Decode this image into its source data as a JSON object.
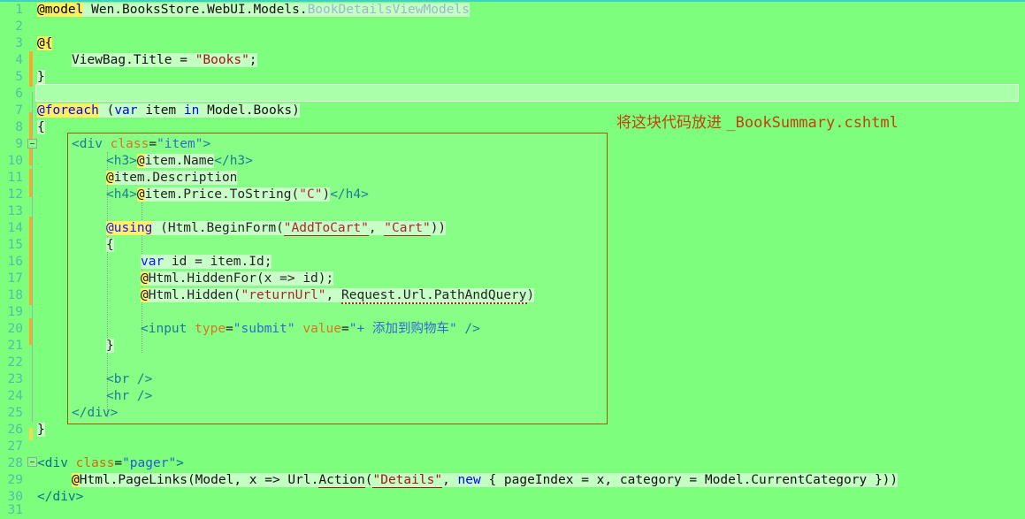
{
  "editor": {
    "app": "visual-studio-code-editor",
    "background_color": "#7dff7d",
    "line_number_color": "#4fbfa8",
    "first_line": 1,
    "last_line": 31,
    "current_line": 6,
    "line_numbers": [
      "1",
      "2",
      "3",
      "4",
      "5",
      "6",
      "7",
      "8",
      "9",
      "10",
      "11",
      "12",
      "13",
      "14",
      "15",
      "16",
      "17",
      "18",
      "19",
      "20",
      "21",
      "22",
      "23",
      "24",
      "25",
      "26",
      "27",
      "28",
      "29",
      "30",
      "31"
    ]
  },
  "annotation": {
    "text_cjk": "将这块代码放进 ",
    "text_file": "_BookSummary.cshtml",
    "color": "#c2410c",
    "box_color": "#9c5b00"
  },
  "code_lines": [
    {
      "n": 1,
      "text": "@model Wen.BooksStore.WebUI.Models.BookDetailsViewModels"
    },
    {
      "n": 2,
      "text": ""
    },
    {
      "n": 3,
      "text": "@{"
    },
    {
      "n": 4,
      "text": "    ViewBag.Title = \"Books\";"
    },
    {
      "n": 5,
      "text": "}"
    },
    {
      "n": 6,
      "text": ""
    },
    {
      "n": 7,
      "text": "@foreach (var item in Model.Books)"
    },
    {
      "n": 8,
      "text": "{"
    },
    {
      "n": 9,
      "text": "    <div class=\"item\">"
    },
    {
      "n": 10,
      "text": "        <h3>@item.Name</h3>"
    },
    {
      "n": 11,
      "text": "        @item.Description"
    },
    {
      "n": 12,
      "text": "        <h4>@item.Price.ToString(\"C\")</h4>"
    },
    {
      "n": 13,
      "text": ""
    },
    {
      "n": 14,
      "text": "        @using (Html.BeginForm(\"AddToCart\", \"Cart\"))"
    },
    {
      "n": 15,
      "text": "        {"
    },
    {
      "n": 16,
      "text": "            var id = item.Id;"
    },
    {
      "n": 17,
      "text": "            @Html.HiddenFor(x => id);"
    },
    {
      "n": 18,
      "text": "            @Html.Hidden(\"returnUrl\", Request.Url.PathAndQuery)"
    },
    {
      "n": 19,
      "text": ""
    },
    {
      "n": 20,
      "text": "            <input type=\"submit\" value=\"+ 添加到购物车\" />"
    },
    {
      "n": 21,
      "text": "        }"
    },
    {
      "n": 22,
      "text": ""
    },
    {
      "n": 23,
      "text": "        <br />"
    },
    {
      "n": 24,
      "text": "        <hr />"
    },
    {
      "n": 25,
      "text": "    </div>"
    },
    {
      "n": 26,
      "text": "}"
    },
    {
      "n": 27,
      "text": ""
    },
    {
      "n": 28,
      "text": "<div class=\"pager\">"
    },
    {
      "n": 29,
      "text": "    @Html.PageLinks(Model, x => Url.Action(\"Details\", new { pageIndex = x, category = Model.CurrentCategory }))"
    },
    {
      "n": 30,
      "text": "</div>"
    },
    {
      "n": 31,
      "text": ""
    }
  ],
  "tokens": {
    "l1": {
      "razor": "@model",
      "ns": " Wen.BooksStore.WebUI.Models.",
      "type": "BookDetailsViewModels"
    },
    "l3": {
      "razor": "@{"
    },
    "l4": {
      "expr": "ViewBag.Title = ",
      "str": "\"Books\"",
      "semi": ";"
    },
    "l5": {
      "brace": "}"
    },
    "l7": {
      "razor": "@foreach",
      "open": " (",
      "kw1": "var",
      "mid": " item ",
      "kw2": "in",
      "tail": " Model.Books)"
    },
    "l8": {
      "brace": "{"
    },
    "l9": {
      "lt": "<",
      "tag": "div",
      "sp": " ",
      "attr": "class",
      "eq": "=",
      "val": "\"item\"",
      "gt": ">"
    },
    "l10": {
      "open": "<h3>",
      "razor": "@",
      "expr": "item.Name",
      "close": "</h3>"
    },
    "l11": {
      "razor": "@",
      "expr": "item.Description"
    },
    "l12": {
      "open": "<h4>",
      "razor": "@",
      "expr": "item.Price.ToString(",
      "str": "\"C\"",
      "paren": ")",
      "close": "</h4>"
    },
    "l14": {
      "razor": "@using",
      "mid": " (Html.BeginForm(",
      "s1": "\"AddToCart\"",
      "comma": ", ",
      "s2": "\"Cart\"",
      "tail": "))"
    },
    "l15": {
      "brace": "{"
    },
    "l16": {
      "kw": "var",
      "rest": " id = item.Id;"
    },
    "l17": {
      "razor": "@",
      "rest": "Html.HiddenFor(x => id);"
    },
    "l18": {
      "razor": "@",
      "call": "Html.Hidden(",
      "str": "\"returnUrl\"",
      "comma": ", ",
      "squig": "Request.Url.PathAndQuery",
      "close": ")"
    },
    "l20": {
      "lt": "<",
      "tag": "input",
      "a1": "type",
      "e1": "=",
      "v1": "\"submit\"",
      "a2": "value",
      "e2": "=",
      "v2a": "\"+ ",
      "cjk": "添加到购物车",
      "v2b": "\"",
      "end": " />"
    },
    "l21": {
      "brace": "}"
    },
    "l23": {
      "tag": "<br />"
    },
    "l24": {
      "tag": "<hr />"
    },
    "l25": {
      "tag": "</div>"
    },
    "l26": {
      "brace": "}"
    },
    "l28": {
      "lt": "<",
      "tag": "div",
      "attr": "class",
      "eq": "=",
      "val": "\"pager\"",
      "gt": ">"
    },
    "l29": {
      "razor": "@",
      "call": "Html.PageLinks(Model, x => Url.",
      "u1": "Action",
      "p1": "(",
      "s1": "\"Details\"",
      "comma": ", ",
      "kw": "new",
      "rest": " { pageIndex = x, category = Model.CurrentCategory }))"
    },
    "l30": {
      "tag": "</div>"
    }
  }
}
